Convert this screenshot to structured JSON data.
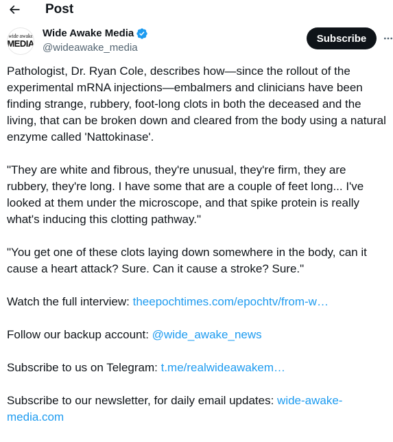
{
  "header": {
    "title": "Post"
  },
  "author": {
    "avatar_line1": "wide awake",
    "avatar_line2": "MEDIA",
    "display_name": "Wide Awake Media",
    "handle": "@wideawake_media",
    "verified": true
  },
  "actions": {
    "subscribe_label": "Subscribe"
  },
  "post": {
    "p1": "Pathologist, Dr. Ryan Cole, describes how—since the rollout of the experimental mRNA injections—embalmers and clinicians have been finding strange, rubbery, foot-long clots in both the deceased and the living, that can be broken down and cleared from the body using a natural enzyme called 'Nattokinase'.",
    "p2": "\"They are white and fibrous, they're unusual, they're firm, they are rubbery, they're long. I have some that are a couple of feet long... I've looked at them under the microscope, and that spike protein is really what's inducing this clotting pathway.\"",
    "p3": "\"You get one of these clots laying down somewhere in the body, can it cause a heart attack? Sure. Can it cause a stroke? Sure.\"",
    "p4_text": "Watch the full interview: ",
    "p4_link": "theepochtimes.com/epochtv/from-w…",
    "p5_text": "Follow our backup account: ",
    "p5_link": "@wide_awake_news",
    "p6_text": "Subscribe to us on Telegram: ",
    "p6_link": "t.me/realwideawakem…",
    "p7_text": "Subscribe to our newsletter, for daily email updates: ",
    "p7_link": "wide-awake-media.com"
  },
  "colors": {
    "text": "#0f1419",
    "secondary": "#536471",
    "link": "#1d9bf0",
    "verified": "#1d9bf0",
    "button_bg": "#0f1419"
  }
}
